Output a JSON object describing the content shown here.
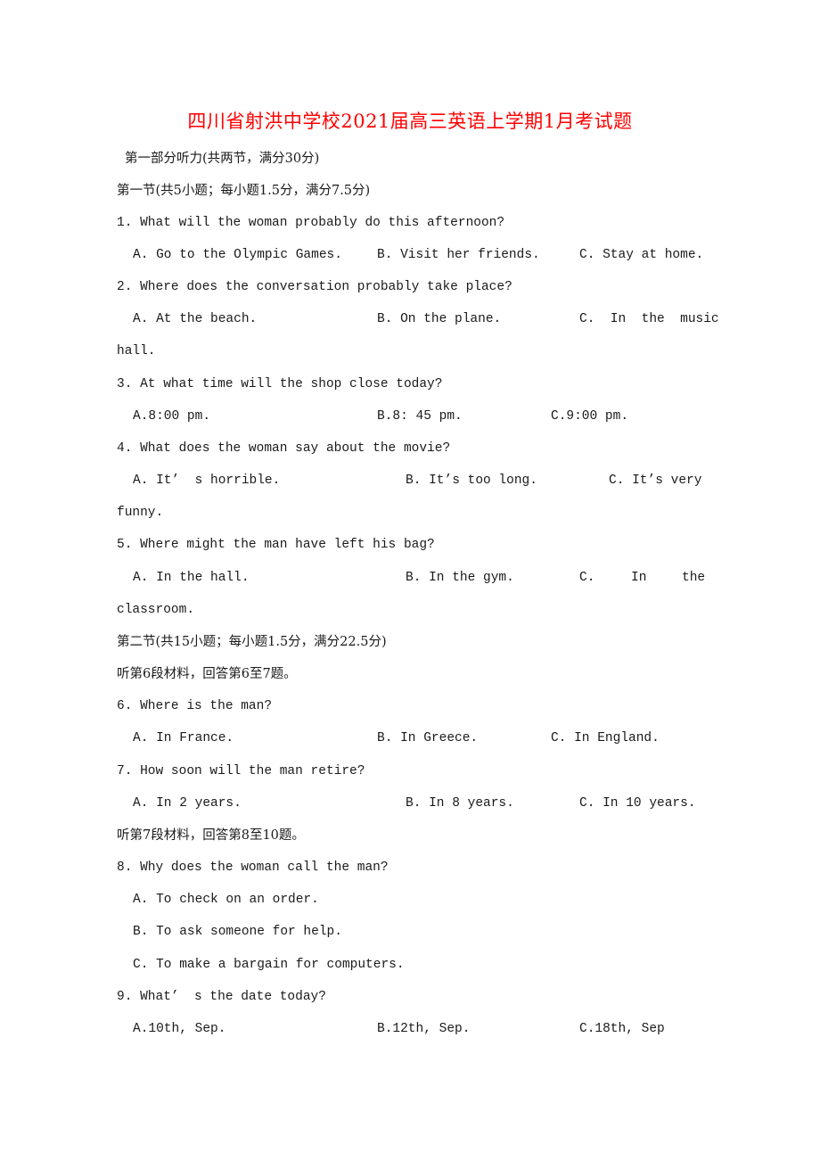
{
  "document": {
    "title": "四川省射洪中学校2021届高三英语上学期1月考试题",
    "part_heading": "第一部分听力(共两节，满分30分)",
    "section1_heading": "第一节(共5小题；每小题1.5分，满分7.5分)",
    "section2_heading": "第二节(共15小题；每小题1.5分，满分22.5分)",
    "instructions": [
      "听第6段材料，回答第6至7题。",
      "听第7段材料，回答第8至10题。"
    ],
    "questions": [
      {
        "number": "1.",
        "stem": "1. What will the woman probably do this afternoon?",
        "options": [
          "A. Go to the Olympic Games.",
          "B. Visit her friends.",
          "C. Stay at home."
        ]
      },
      {
        "number": "2.",
        "stem": "2. Where does the conversation probably take place?",
        "options": [
          "A. At the beach.",
          "B. On the plane.",
          "C.  In  the  music"
        ],
        "wrap": "hall."
      },
      {
        "number": "3.",
        "stem": "3. At what time will the shop close today?",
        "options": [
          "A.8:00 pm.",
          "B.8: 45 pm.",
          "C.9:00 pm."
        ]
      },
      {
        "number": "4.",
        "stem": "4. What does the woman say about the movie?",
        "options": [
          "A. It’  s horrible.",
          "B. It’s too long.",
          "C. It’s very"
        ],
        "wrap": "funny."
      },
      {
        "number": "5.",
        "stem": "5. Where might the man have left his bag?",
        "options": [
          "A. In the hall.",
          "B. In the gym.",
          "C.",
          "In",
          "the"
        ],
        "wrap": "classroom."
      },
      {
        "number": "6.",
        "stem": "6. Where is the man?",
        "options": [
          "A. In France.",
          "B. In Greece.",
          "C. In England."
        ]
      },
      {
        "number": "7.",
        "stem": "7. How soon will the man retire?",
        "options": [
          "A. In 2 years.",
          "B. In 8 years.",
          "C. In 10 years."
        ]
      },
      {
        "number": "8.",
        "stem": "8. Why does the woman call the man?",
        "options": [
          "A. To check on an order.",
          "B. To ask someone for help.",
          "C. To make a bargain for computers."
        ]
      },
      {
        "number": "9.",
        "stem": "9. What’  s the date today?",
        "options": [
          "A.10th, Sep.",
          "B.12th, Sep.",
          "C.18th, Sep"
        ]
      }
    ]
  }
}
